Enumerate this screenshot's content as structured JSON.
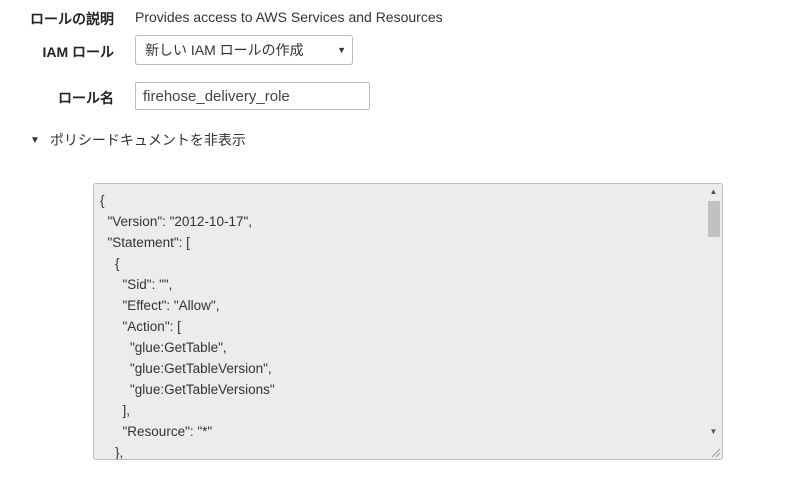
{
  "role_description": {
    "label": "ロールの説明",
    "value": "Provides access to AWS Services and Resources"
  },
  "iam_role": {
    "label": "IAM ロール",
    "selected": "新しい IAM ロールの作成"
  },
  "role_name": {
    "label": "ロール名",
    "value": "firehose_delivery_role"
  },
  "policy_toggle": {
    "label": "ポリシードキュメントを非表示"
  },
  "policy_document": {
    "text": "{\n  \"Version\": \"2012-10-17\",\n  \"Statement\": [\n    {\n      \"Sid\": \"\",\n      \"Effect\": \"Allow\",\n      \"Action\": [\n        \"glue:GetTable\",\n        \"glue:GetTableVersion\",\n        \"glue:GetTableVersions\"\n      ],\n      \"Resource\": \"*\"\n    },"
  }
}
